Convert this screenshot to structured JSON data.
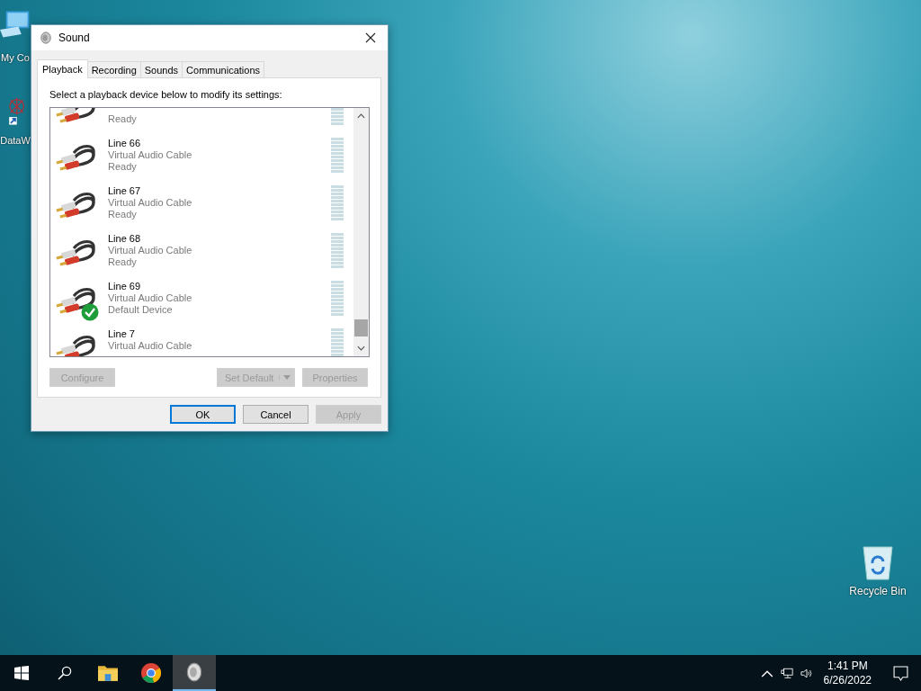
{
  "desktop_icons": [
    {
      "kind": "computer",
      "label": "My Co"
    },
    {
      "kind": "shortcut",
      "label": "DataW"
    },
    {
      "kind": "recycle-bin",
      "label": "Recycle Bin"
    }
  ],
  "window": {
    "title": "Sound"
  },
  "tabs": [
    {
      "label": "Playback",
      "selected": true
    },
    {
      "label": "Recording",
      "selected": false
    },
    {
      "label": "Sounds",
      "selected": false
    },
    {
      "label": "Communications",
      "selected": false
    }
  ],
  "instruction": "Select a playback device below to modify its settings:",
  "devices": [
    {
      "status": "Ready",
      "default": false
    },
    {
      "name": "Line 66",
      "description": "Virtual Audio Cable",
      "status": "Ready",
      "default": false
    },
    {
      "name": "Line 67",
      "description": "Virtual Audio Cable",
      "status": "Ready",
      "default": false
    },
    {
      "name": "Line 68",
      "description": "Virtual Audio Cable",
      "status": "Ready",
      "default": false
    },
    {
      "name": "Line 69",
      "description": "Virtual Audio Cable",
      "status": "Default Device",
      "default": true
    },
    {
      "name": "Line 7",
      "description": "Virtual Audio Cable",
      "default": false
    }
  ],
  "device_buttons": [
    {
      "kind": "plain",
      "label": "Configure",
      "disabled": true
    },
    {
      "kind": "split",
      "label": "Set Default",
      "disabled": true
    },
    {
      "kind": "plain",
      "label": "Properties",
      "disabled": true
    }
  ],
  "dialog_buttons": [
    {
      "label": "OK",
      "disabled": false,
      "focused": true
    },
    {
      "label": "Cancel",
      "disabled": false,
      "focused": false
    },
    {
      "label": "Apply",
      "disabled": true,
      "focused": false
    }
  ],
  "taskbar": {
    "items": [
      {
        "kind": "start",
        "selected": false
      },
      {
        "kind": "search",
        "selected": false
      },
      {
        "kind": "folder",
        "selected": false
      },
      {
        "kind": "browser",
        "selected": false
      },
      {
        "kind": "sound",
        "selected": true
      }
    ],
    "time": "1:41 PM",
    "date": "6/26/2022"
  }
}
